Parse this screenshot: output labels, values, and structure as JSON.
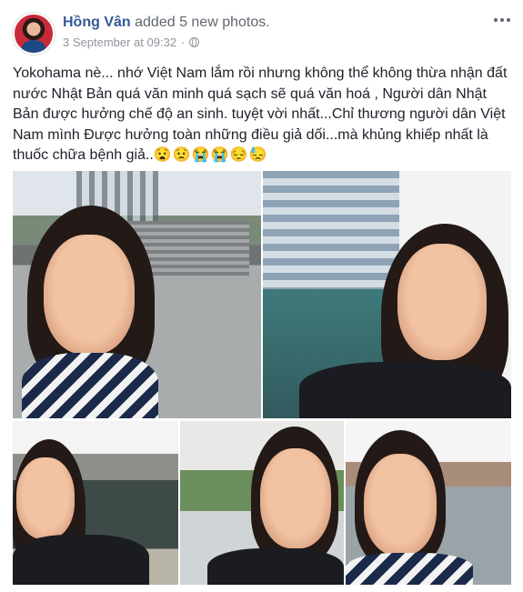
{
  "post": {
    "author": "Hồng Vân",
    "action": "added 5 new photos.",
    "timestamp": "3 September at 09:32",
    "separator": "·",
    "privacy_icon": "globe-icon",
    "more_icon": "more-options-icon",
    "text": "Yokohama nè... nhớ Việt Nam lắm rồi nhưng không thể không thừa nhận đất nước Nhật Bản quá văn minh quá sạch sẽ quá văn hoá , Người dân Nhật Bản được hưởng chế độ an sinh. tuyệt vời nhất...Chỉ thương người dân Việt Nam mình Được hưởng toàn những điều giả dối...mà khủng khiếp nhất là thuốc chữa bệnh giả..",
    "emojis": "😧😟😭😭😔😓"
  },
  "photos": {
    "count": 5
  },
  "colors": {
    "author_link": "#365899",
    "meta_text": "#90949c",
    "body_text": "#1d2129"
  }
}
